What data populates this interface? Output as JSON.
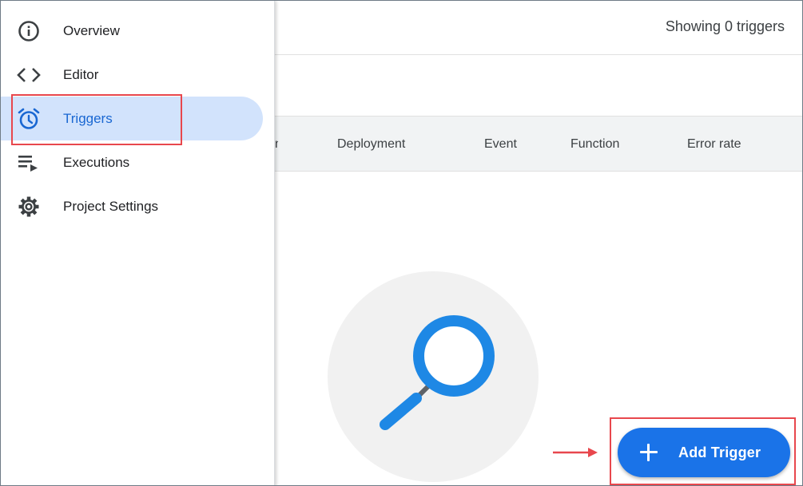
{
  "sidebar": {
    "items": [
      {
        "label": "Overview",
        "icon": "info-icon",
        "active": false
      },
      {
        "label": "Editor",
        "icon": "code-icon",
        "active": false
      },
      {
        "label": "Triggers",
        "icon": "alarm-clock-icon",
        "active": true
      },
      {
        "label": "Executions",
        "icon": "playlist-play-icon",
        "active": false
      },
      {
        "label": "Project Settings",
        "icon": "gear-icon",
        "active": false
      }
    ]
  },
  "header": {
    "showing": "Showing 0 triggers"
  },
  "table": {
    "columns": [
      "n",
      "Deployment",
      "Event",
      "Function",
      "Error rate"
    ]
  },
  "actions": {
    "add_trigger": "Add Trigger"
  },
  "colors": {
    "accent": "#1a73e8",
    "active_bg": "#d2e3fc",
    "highlight": "#e8474d",
    "magnifier": "#1e88e5"
  }
}
